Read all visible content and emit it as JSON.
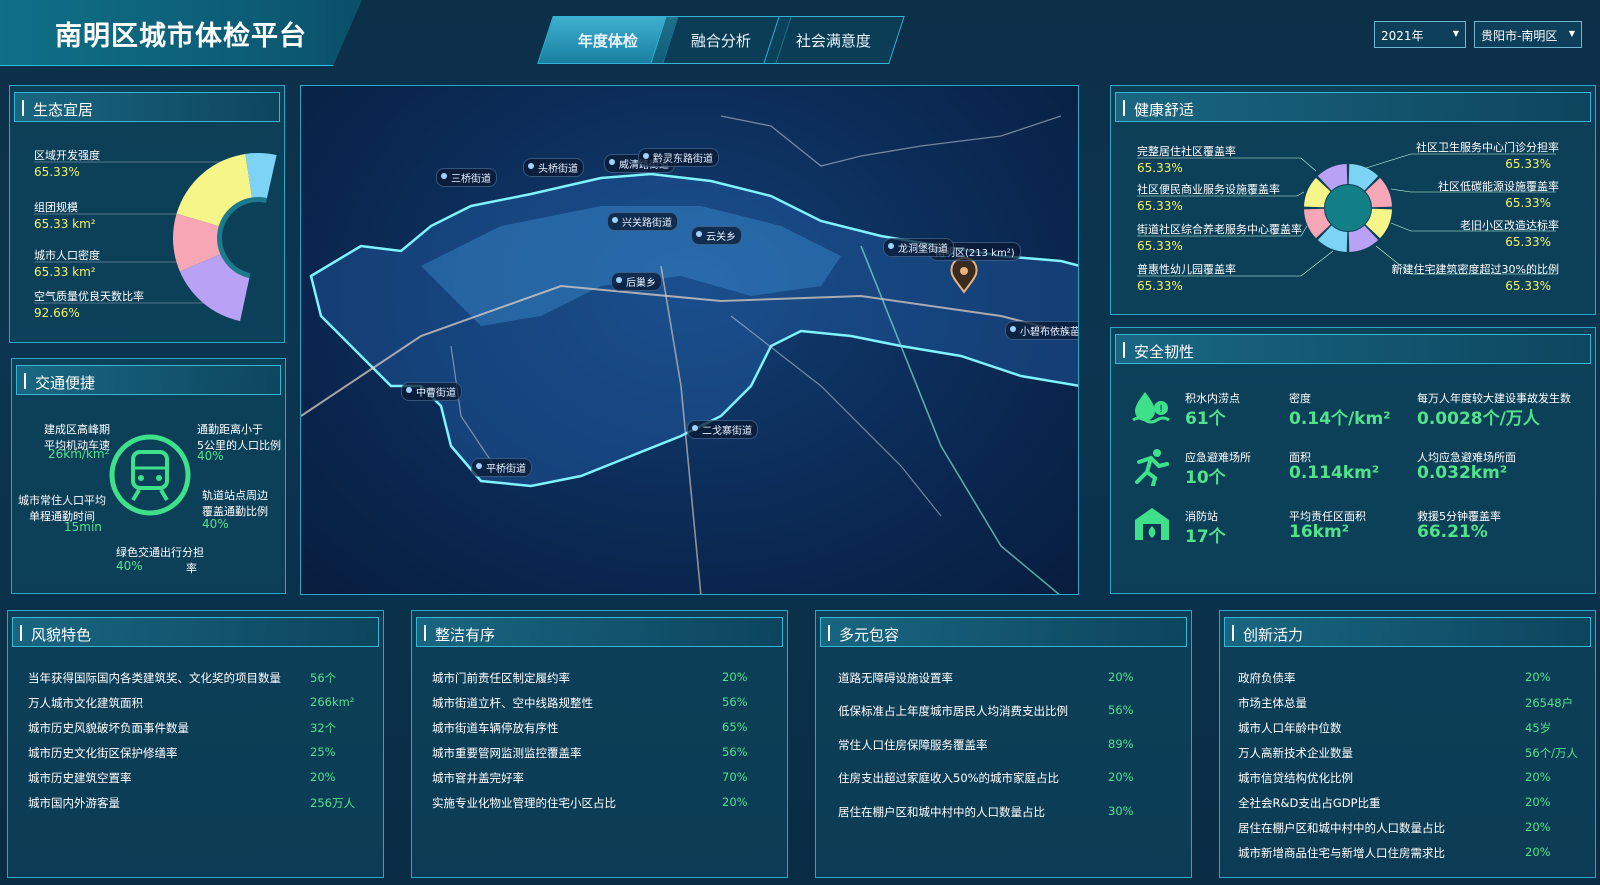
{
  "header": {
    "title": "南明区城市体检平台",
    "tabs": [
      {
        "label": "年度体检"
      },
      {
        "label": "融合分析"
      },
      {
        "label": "社会满意度"
      }
    ],
    "year_select": "2021年",
    "region_select": "贵阳市-南明区"
  },
  "eco": {
    "title": "生态宜居",
    "items": [
      {
        "label": "区域开发强度",
        "value": "65.33%"
      },
      {
        "label": "组团规模",
        "value": "65.33 km²"
      },
      {
        "label": "城市人口密度",
        "value": "65.33 km²"
      },
      {
        "label": "空气质量优良天数比率",
        "value": "92.66%"
      }
    ],
    "colors": [
      "#7dd3f5",
      "#f6f58a",
      "#f7a6b6",
      "#b9a2f5"
    ]
  },
  "traffic": {
    "title": "交通便捷",
    "items": [
      {
        "label_l1": "建成区高峰期",
        "label_l2": "平均机动车速",
        "value": "26km/km²"
      },
      {
        "label_l1": "通勤距离小于",
        "label_l2": "5公里的人口比例",
        "value": "40%"
      },
      {
        "label_l1": "城市常住人口平均",
        "label_l2": "单程通勤时间",
        "value": "15min"
      },
      {
        "label_l1": "轨道站点周边",
        "label_l2": "覆盖通勤比例",
        "value": "40%"
      },
      {
        "label_l1": "绿色交通出行分担",
        "label_l2": "率",
        "value": "40%"
      }
    ]
  },
  "health": {
    "title": "健康舒适",
    "left": [
      {
        "label": "完整居住社区覆盖率",
        "value": "65.33%"
      },
      {
        "label": "社区便民商业服务设施覆盖率",
        "value": "65.33%"
      },
      {
        "label": "街道社区综合养老服务中心覆盖率",
        "value": "65.33%"
      },
      {
        "label": "普惠性幼儿园覆盖率",
        "value": "65.33%"
      }
    ],
    "right": [
      {
        "label": "社区卫生服务中心门诊分担率",
        "value": "65.33%"
      },
      {
        "label": "社区低碳能源设施覆盖率",
        "value": "65.33%"
      },
      {
        "label": "老旧小区改造达标率",
        "value": "65.33%"
      },
      {
        "label": "新建住宅建筑密度超过30%的比例",
        "value": "65.33%"
      }
    ]
  },
  "safety": {
    "title": "安全韧性",
    "rows": [
      {
        "icon": "waterlogging-icon",
        "cells": [
          {
            "label": "积水内涝点",
            "value": "61个"
          },
          {
            "label": "密度",
            "value": "0.14个/km²"
          },
          {
            "label": "每万人年度较大建设事故发生数",
            "value": "0.0028个/万人"
          }
        ]
      },
      {
        "icon": "running-person-icon",
        "cells": [
          {
            "label": "应急避难场所",
            "value": "10个"
          },
          {
            "label": "面积",
            "value": "0.114km²"
          },
          {
            "label": "人均应急避难场所面",
            "value": "0.032km²"
          }
        ]
      },
      {
        "icon": "fire-station-icon",
        "cells": [
          {
            "label": "消防站",
            "value": "17个"
          },
          {
            "label": "平均责任区面积",
            "value": "16km²"
          },
          {
            "label": "救援5分钟覆盖率",
            "value": "66.21%"
          }
        ]
      }
    ]
  },
  "map": {
    "region_label": "南明区(213 km²)",
    "labels": [
      "三桥街道",
      "头桥街道",
      "威清路街道",
      "黔灵东路街道",
      "兴关路街道",
      "云关乡",
      "龙洞堡街道",
      "后巢乡",
      "小碧布依族苗族乡",
      "中曹街道",
      "二戈寨街道",
      "平桥街道"
    ]
  },
  "bottom": [
    {
      "title": "风貌特色",
      "items": [
        {
          "label": "当年获得国际国内各类建筑奖、文化奖的项目数量",
          "value": "56个"
        },
        {
          "label": "万人城市文化建筑面积",
          "value": "266km²"
        },
        {
          "label": "城市历史风貌破坏负面事件数量",
          "value": "32个"
        },
        {
          "label": "城市历史文化街区保护修缮率",
          "value": "25%"
        },
        {
          "label": "城市历史建筑空置率",
          "value": "20%"
        },
        {
          "label": "城市国内外游客量",
          "value": "256万人"
        }
      ]
    },
    {
      "title": "整洁有序",
      "items": [
        {
          "label": "城市门前责任区制定履约率",
          "value": "20%"
        },
        {
          "label": "城市街道立杆、空中线路规整性",
          "value": "56%"
        },
        {
          "label": "城市街道车辆停放有序性",
          "value": "65%"
        },
        {
          "label": "城市重要管网监测监控覆盖率",
          "value": "56%"
        },
        {
          "label": "城市窨井盖完好率",
          "value": "70%"
        },
        {
          "label": "实施专业化物业管理的住宅小区占比",
          "value": "20%"
        }
      ]
    },
    {
      "title": "多元包容",
      "items": [
        {
          "label": "道路无障碍设施设置率",
          "value": "20%"
        },
        {
          "label": "低保标准占上年度城市居民人均消费支出比例",
          "value": "56%"
        },
        {
          "label": "常住人口住房保障服务覆盖率",
          "value": "89%"
        },
        {
          "label": "住房支出超过家庭收入50%的城市家庭占比",
          "value": "20%"
        },
        {
          "label": "居住在棚户区和城中村中的人口数量占比",
          "value": "30%"
        }
      ]
    },
    {
      "title": "创新活力",
      "items": [
        {
          "label": "政府负债率",
          "value": "20%"
        },
        {
          "label": "市场主体总量",
          "value": "26548户"
        },
        {
          "label": "城市人口年龄中位数",
          "value": "45岁"
        },
        {
          "label": "万人高新技术企业数量",
          "value": "56个/万人"
        },
        {
          "label": "城市信贷结构优化比例",
          "value": "20%"
        },
        {
          "label": "全社会R&D支出占GDP比重",
          "value": "20%"
        },
        {
          "label": "居住在棚户区和城中村中的人口数量占比",
          "value": "20%"
        },
        {
          "label": "城市新增商品住宅与新增人口住房需求比",
          "value": "20%"
        }
      ]
    }
  ]
}
